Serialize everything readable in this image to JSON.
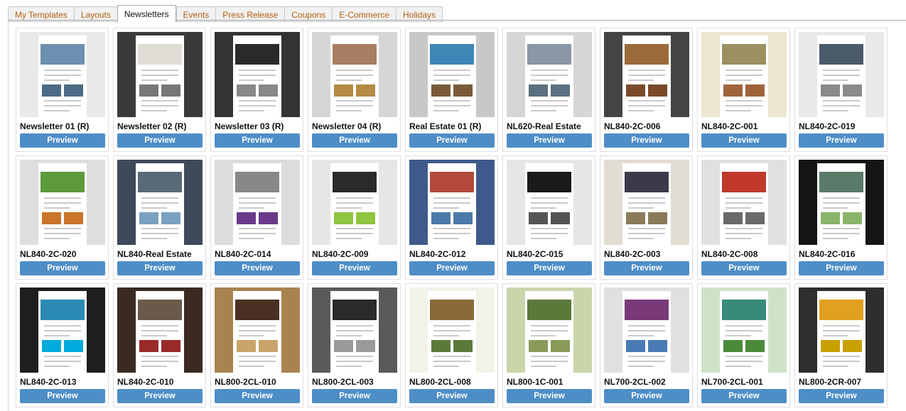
{
  "tabs": [
    {
      "label": "My Templates",
      "active": false
    },
    {
      "label": "Layouts",
      "active": false
    },
    {
      "label": "Newsletters",
      "active": true
    },
    {
      "label": "Events",
      "active": false
    },
    {
      "label": "Press Release",
      "active": false
    },
    {
      "label": "Coupons",
      "active": false
    },
    {
      "label": "E-Commerce",
      "active": false
    },
    {
      "label": "Holidays",
      "active": false
    }
  ],
  "preview_label": "Preview",
  "colors": {
    "tab_text": "#b06010",
    "preview_button": "#4e8ec6"
  },
  "templates": [
    {
      "name": "Newsletter 01 (R)",
      "bg": "#e9e9e9",
      "hero": "#6d8fb0",
      "accent": "#4a6a86"
    },
    {
      "name": "Newsletter 02 (R)",
      "bg": "#3a3a3a",
      "hero": "#e0ddd6",
      "accent": "#777777"
    },
    {
      "name": "Newsletter 03 (R)",
      "bg": "#333333",
      "hero": "#2a2a2a",
      "accent": "#888888"
    },
    {
      "name": "Newsletter 04 (R)",
      "bg": "#d6d6d6",
      "hero": "#a87e63",
      "accent": "#b48a44"
    },
    {
      "name": "Real Estate 01 (R)",
      "bg": "#c8c8c8",
      "hero": "#3f86b7",
      "accent": "#7a5a3a"
    },
    {
      "name": "NL620-Real Estate",
      "bg": "#d6d6d6",
      "hero": "#8a97a8",
      "accent": "#58707f"
    },
    {
      "name": "NL840-2C-006",
      "bg": "#444444",
      "hero": "#9a6a3a",
      "accent": "#7a4a2a"
    },
    {
      "name": "NL840-2C-001",
      "bg": "#ece6cf",
      "hero": "#9b9060",
      "accent": "#a0643a"
    },
    {
      "name": "NL840-2C-019",
      "bg": "#e9e9e9",
      "hero": "#4a5a6a",
      "accent": "#8a8a8a"
    },
    {
      "name": "NL840-2C-020",
      "bg": "#dedede",
      "hero": "#5c9a3c",
      "accent": "#c9742a"
    },
    {
      "name": "NL840-Real Estate",
      "bg": "#3c4a5a",
      "hero": "#5a6a7a",
      "accent": "#7aa0c0"
    },
    {
      "name": "NL840-2C-014",
      "bg": "#dcdcdc",
      "hero": "#888888",
      "accent": "#6a3a8a"
    },
    {
      "name": "NL840-2C-009",
      "bg": "#e6e6e6",
      "hero": "#2a2a2a",
      "accent": "#8ec63f"
    },
    {
      "name": "NL840-2C-012",
      "bg": "#3f5a8a",
      "hero": "#b34a3a",
      "accent": "#4a7aa8"
    },
    {
      "name": "NL840-2C-015",
      "bg": "#e6e6e6",
      "hero": "#1a1a1a",
      "accent": "#555555"
    },
    {
      "name": "NL840-2C-003",
      "bg": "#e2ddd2",
      "hero": "#3a3a4a",
      "accent": "#8a7a5a"
    },
    {
      "name": "NL840-2C-008",
      "bg": "#e0e0e0",
      "hero": "#c0392b",
      "accent": "#6a6a6a"
    },
    {
      "name": "NL840-2C-016",
      "bg": "#151515",
      "hero": "#5a7a6a",
      "accent": "#8ab46a"
    },
    {
      "name": "NL840-2C-013",
      "bg": "#1e1e1e",
      "hero": "#2a8ab4",
      "accent": "#00aadd"
    },
    {
      "name": "NL840-2C-010",
      "bg": "#3a2a22",
      "hero": "#6a5a4a",
      "accent": "#9a2a2a"
    },
    {
      "name": "NL800-2CL-010",
      "bg": "#a9834f",
      "hero": "#4a3022",
      "accent": "#c9a46a"
    },
    {
      "name": "NL800-2CL-003",
      "bg": "#5a5a5a",
      "hero": "#2a2a2a",
      "accent": "#9a9a9a"
    },
    {
      "name": "NL800-2CL-008",
      "bg": "#f2f2e8",
      "hero": "#8a6a3a",
      "accent": "#5a7a3a"
    },
    {
      "name": "NL800-1C-001",
      "bg": "#c9d6ac",
      "hero": "#5a7a3a",
      "accent": "#8a9a5a"
    },
    {
      "name": "NL700-2CL-002",
      "bg": "#e0e0e0",
      "hero": "#7a3a7a",
      "accent": "#4a7ab4"
    },
    {
      "name": "NL700-2CL-001",
      "bg": "#cfe2c8",
      "hero": "#3a8a7a",
      "accent": "#4a8a3a"
    },
    {
      "name": "NL800-2CR-007",
      "bg": "#2e2e2e",
      "hero": "#e0a020",
      "accent": "#c8a000"
    }
  ]
}
